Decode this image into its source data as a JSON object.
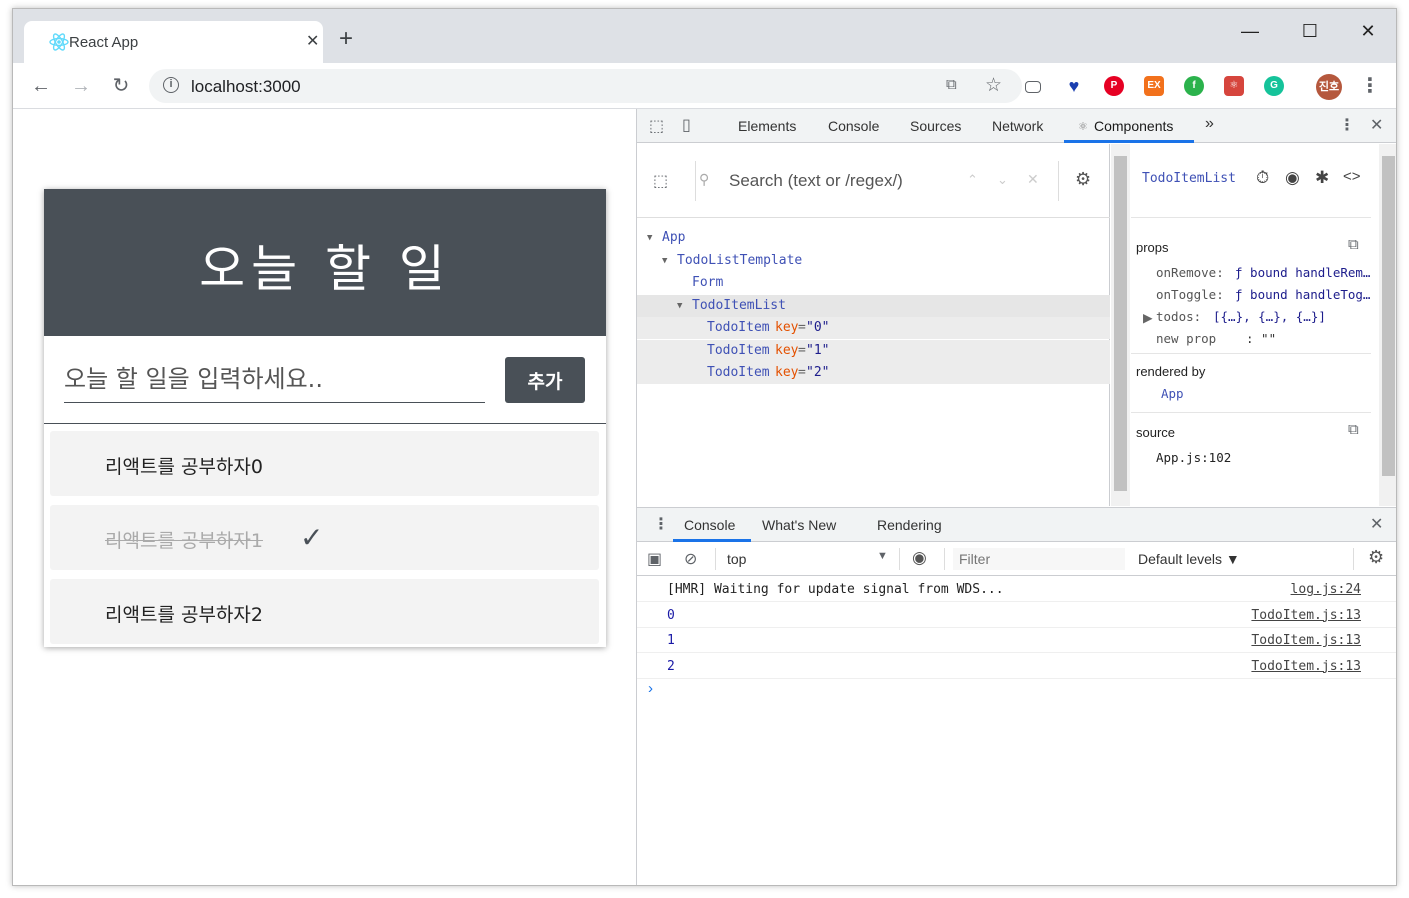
{
  "browser": {
    "tab_title": "React App",
    "tab_close": "✕",
    "new_tab": "+",
    "url": "localhost:3000",
    "window_controls": {
      "minimize": "—",
      "maximize": "☐",
      "close": "✕"
    },
    "profile_initials": "진호",
    "extensions": [
      "translate-icon",
      "star-icon",
      "cast-icon",
      "vivaldi-icon",
      "pinterest-icon",
      "ex-icon",
      "feedly-icon",
      "react-icon",
      "grammarly-icon"
    ]
  },
  "app": {
    "title": "오늘 할 일",
    "input_placeholder": "오늘 할 일을 입력하세요..",
    "add_button": "추가",
    "todos": [
      {
        "text": "리액트를 공부하자0",
        "done": false
      },
      {
        "text": "리액트를 공부하자1",
        "done": true
      },
      {
        "text": "리액트를 공부하자2",
        "done": false
      }
    ],
    "check_mark": "✓"
  },
  "devtools": {
    "tabs": [
      "Elements",
      "Console",
      "Sources",
      "Network",
      "Components"
    ],
    "active_tab": "Components",
    "more": "»",
    "search_placeholder": "Search (text or /regex/)",
    "tree": [
      {
        "name": "App",
        "depth": 0,
        "expanded": true
      },
      {
        "name": "TodoListTemplate",
        "depth": 1,
        "expanded": true
      },
      {
        "name": "Form",
        "depth": 2
      },
      {
        "name": "TodoItemList",
        "depth": 2,
        "expanded": true,
        "selected": true
      },
      {
        "name": "TodoItem",
        "depth": 3,
        "key": "key",
        "val": "\"0\""
      },
      {
        "name": "TodoItem",
        "depth": 3,
        "key": "key",
        "val": "\"1\""
      },
      {
        "name": "TodoItem",
        "depth": 3,
        "key": "key",
        "val": "\"2\""
      }
    ],
    "selected_component": "TodoItemList",
    "props_label": "props",
    "props": [
      {
        "key": "onRemove:",
        "value": "ƒ bound handleRem…"
      },
      {
        "key": "onToggle:",
        "value": "ƒ bound handleTog…"
      },
      {
        "key": "todos:",
        "value": "[{…}, {…}, {…}]"
      },
      {
        "key": "new prop",
        "value": ":  \"\""
      }
    ],
    "rendered_by_label": "rendered by",
    "rendered_by": "App",
    "source_label": "source",
    "source": "App.js:102",
    "drawer_tabs": [
      "Console",
      "What's New",
      "Rendering"
    ],
    "context": "top",
    "filter_placeholder": "Filter",
    "levels": "Default levels ▼",
    "logs": [
      {
        "msg": "[HMR] Waiting for update signal from WDS...",
        "src": "log.js:24",
        "numeric": false
      },
      {
        "msg": "0",
        "src": "TodoItem.js:13",
        "numeric": true
      },
      {
        "msg": "1",
        "src": "TodoItem.js:13",
        "numeric": true
      },
      {
        "msg": "2",
        "src": "TodoItem.js:13",
        "numeric": true
      }
    ],
    "prompt": "›"
  }
}
